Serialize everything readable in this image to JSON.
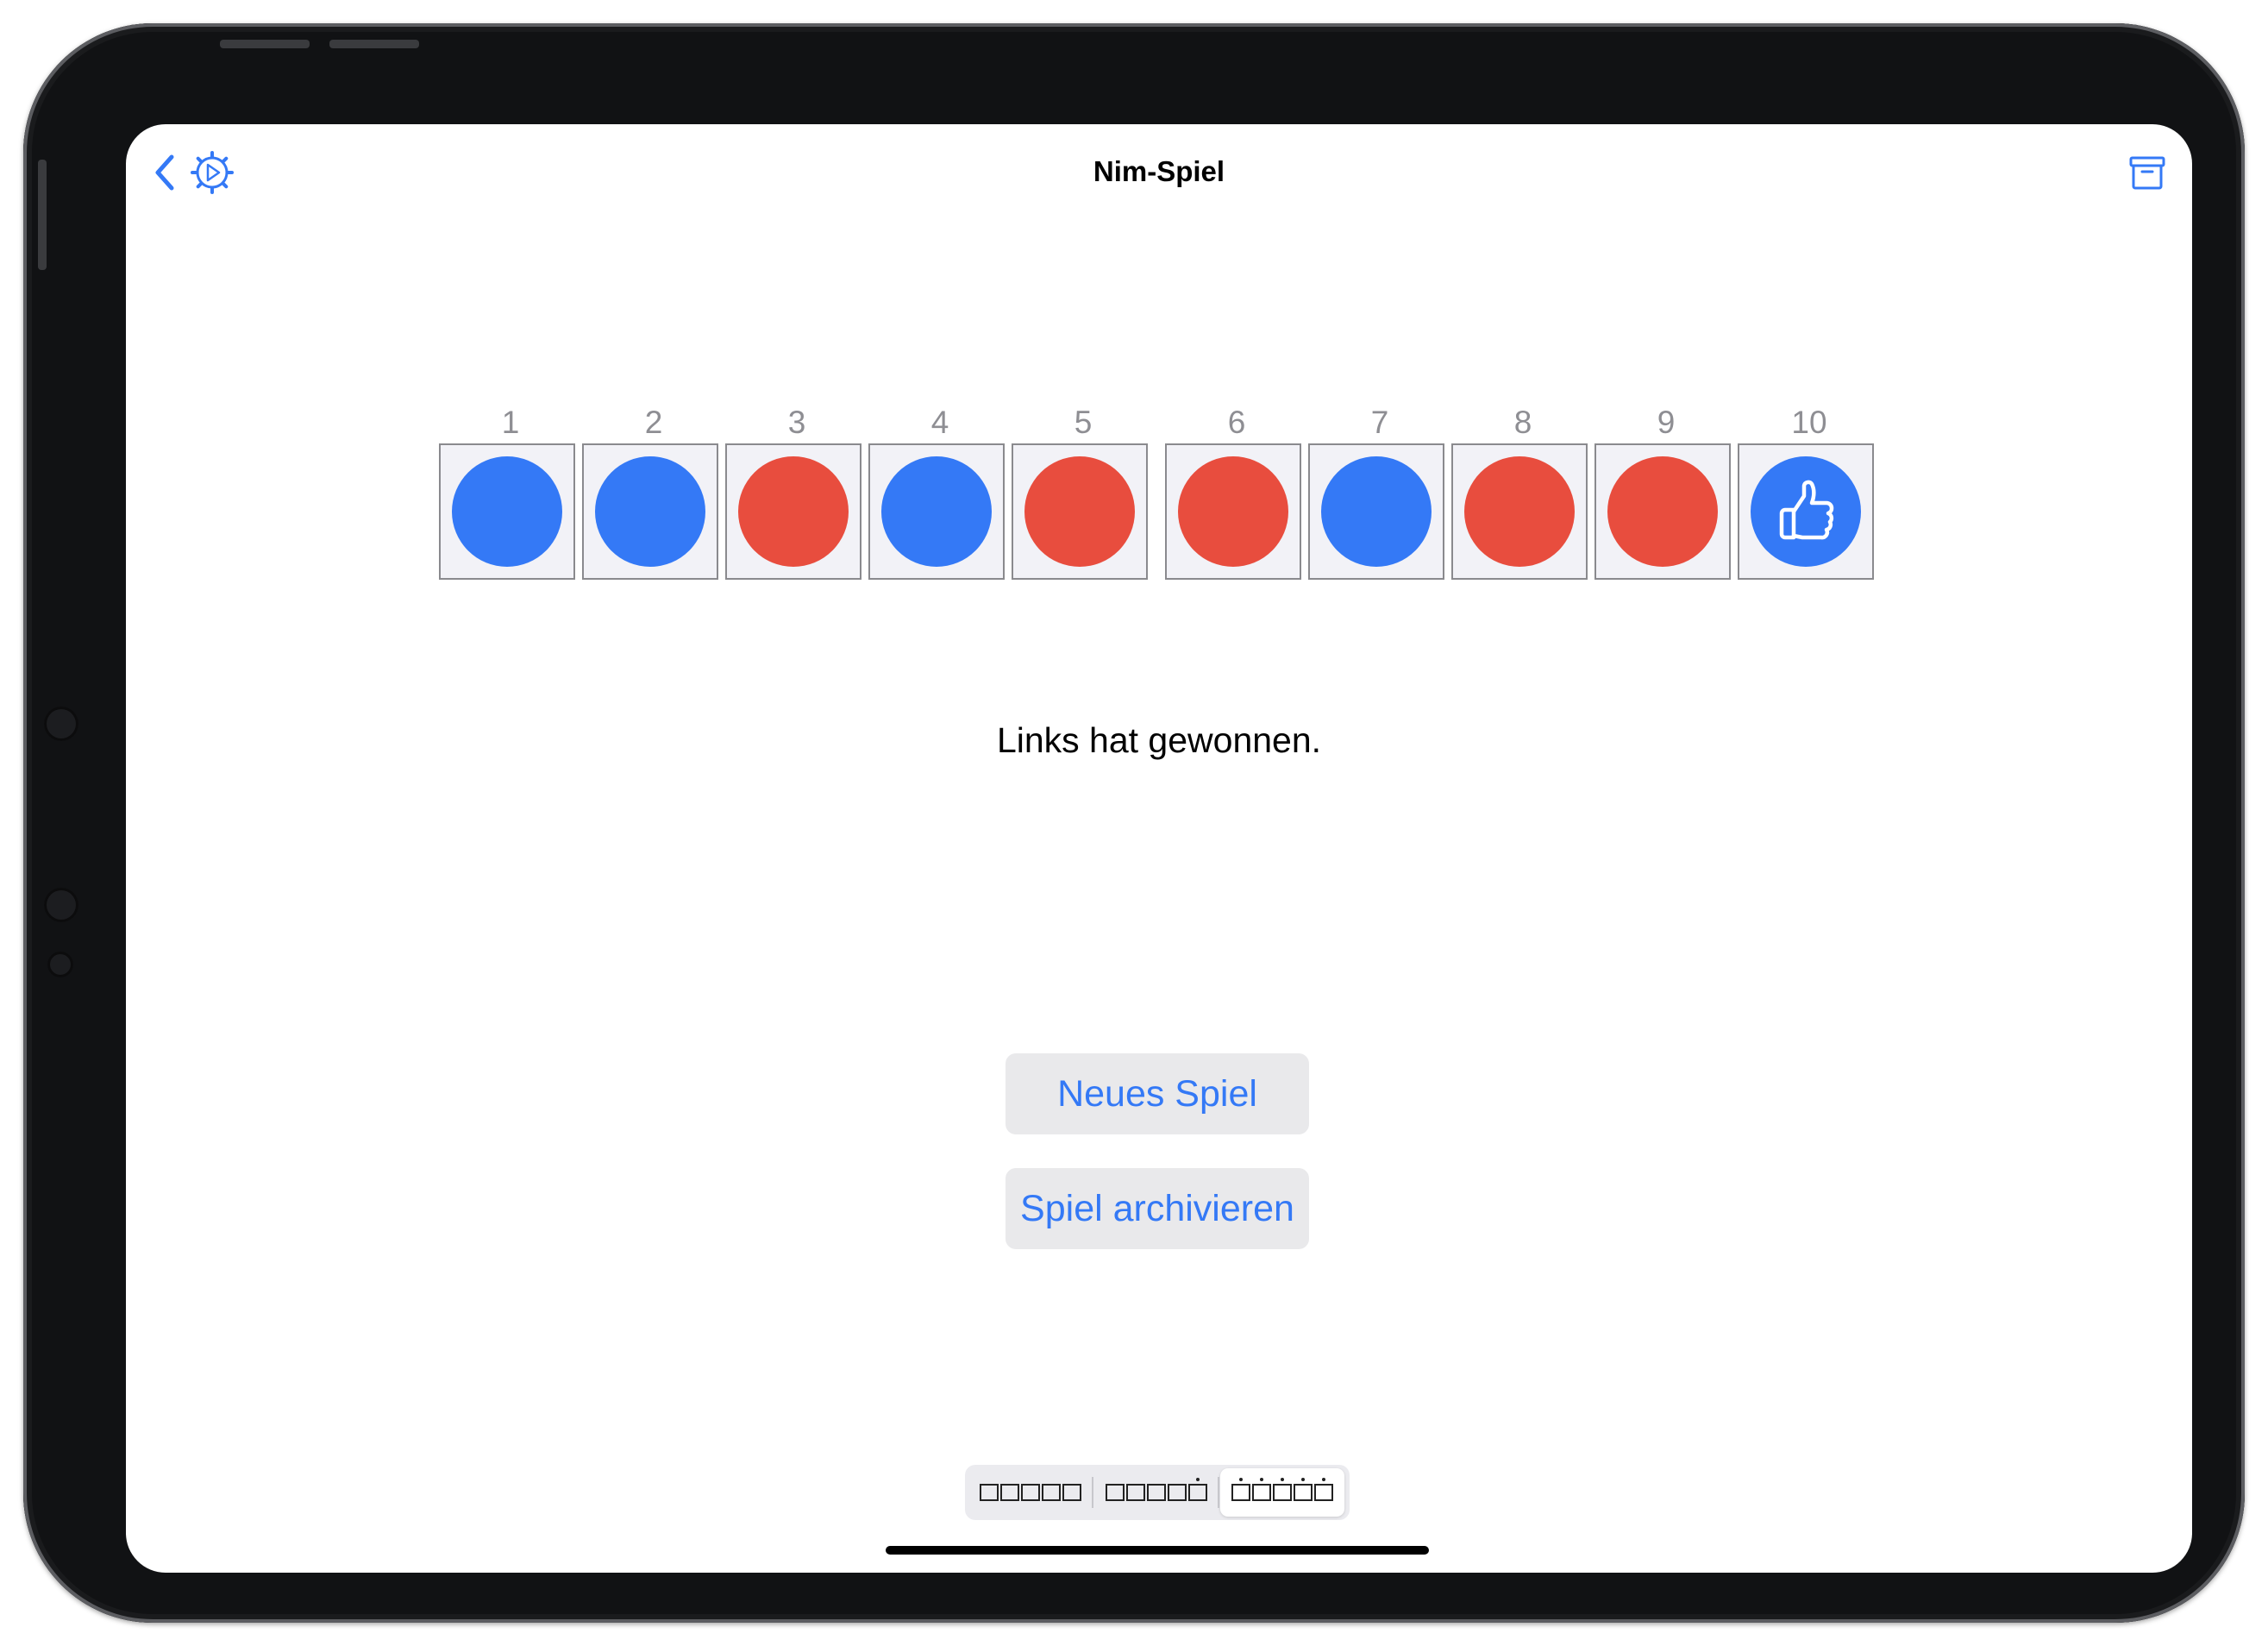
{
  "nav": {
    "title": "Nim-Spiel",
    "back_icon": "chevron-left-icon",
    "settings_icon": "gear-play-icon",
    "archive_icon": "archive-box-icon"
  },
  "colors": {
    "blue": "#3479f6",
    "red": "#e84d3e",
    "cell_bg": "#f2f2f7"
  },
  "board": {
    "cells": [
      {
        "number": "1",
        "token": "blue"
      },
      {
        "number": "2",
        "token": "blue"
      },
      {
        "number": "3",
        "token": "red"
      },
      {
        "number": "4",
        "token": "blue"
      },
      {
        "number": "5",
        "token": "red"
      },
      {
        "number": "6",
        "token": "red"
      },
      {
        "number": "7",
        "token": "blue"
      },
      {
        "number": "8",
        "token": "red"
      },
      {
        "number": "9",
        "token": "red"
      },
      {
        "number": "10",
        "token": "blue-thumbs-up"
      }
    ]
  },
  "status": "Links hat gewonnen.",
  "buttons": {
    "new_game": "Neues Spiel",
    "archive_game": "Spiel archivieren"
  },
  "segmented": {
    "selected_index": 2,
    "segments": [
      "no-dots",
      "one-dot",
      "five-dots"
    ]
  }
}
